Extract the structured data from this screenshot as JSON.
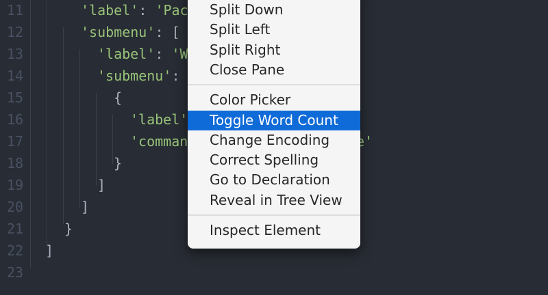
{
  "editor": {
    "lines": [
      {
        "num": "11",
        "segments": [
          {
            "text": "'label'",
            "type": "str"
          },
          {
            "text": ": ",
            "type": "punc"
          },
          {
            "text": "'Pac",
            "type": "str"
          }
        ]
      },
      {
        "num": "12",
        "segments": [
          {
            "text": "'submenu'",
            "type": "str"
          },
          {
            "text": ": [",
            "type": "punc"
          }
        ]
      },
      {
        "num": "13",
        "segments": [
          {
            "text": "'label'",
            "type": "str"
          },
          {
            "text": ": ",
            "type": "punc"
          },
          {
            "text": "'W",
            "type": "str"
          }
        ]
      },
      {
        "num": "14",
        "segments": [
          {
            "text": "'submenu'",
            "type": "str"
          },
          {
            "text": ": ",
            "type": "punc"
          }
        ]
      },
      {
        "num": "15",
        "segments": [
          {
            "text": "{",
            "type": "punc"
          }
        ]
      },
      {
        "num": "16",
        "segments": [
          {
            "text": "'label'",
            "type": "str"
          }
        ]
      },
      {
        "num": "17",
        "segments": [
          {
            "text": "'comman",
            "type": "str"
          },
          {
            "text": "e'",
            "type": "str"
          }
        ]
      },
      {
        "num": "18",
        "segments": [
          {
            "text": "}",
            "type": "punc"
          }
        ]
      },
      {
        "num": "19",
        "segments": [
          {
            "text": "]",
            "type": "punc"
          }
        ]
      },
      {
        "num": "20",
        "segments": [
          {
            "text": "]",
            "type": "punc"
          }
        ]
      },
      {
        "num": "21",
        "segments": [
          {
            "text": "}",
            "type": "punc"
          }
        ]
      },
      {
        "num": "22",
        "segments": [
          {
            "text": "]",
            "type": "punc"
          }
        ]
      },
      {
        "num": "23",
        "segments": []
      }
    ]
  },
  "context_menu": {
    "groups": [
      {
        "items": [
          {
            "label": "Split Down"
          },
          {
            "label": "Split Left"
          },
          {
            "label": "Split Right"
          },
          {
            "label": "Close Pane"
          }
        ]
      },
      {
        "items": [
          {
            "label": "Color Picker"
          },
          {
            "label": "Toggle Word Count",
            "highlighted": true
          },
          {
            "label": "Change Encoding"
          },
          {
            "label": "Correct Spelling"
          },
          {
            "label": "Go to Declaration"
          },
          {
            "label": "Reveal in Tree View"
          }
        ]
      },
      {
        "items": [
          {
            "label": "Inspect Element"
          }
        ]
      }
    ],
    "highlight_color": "#0f6bd7"
  }
}
